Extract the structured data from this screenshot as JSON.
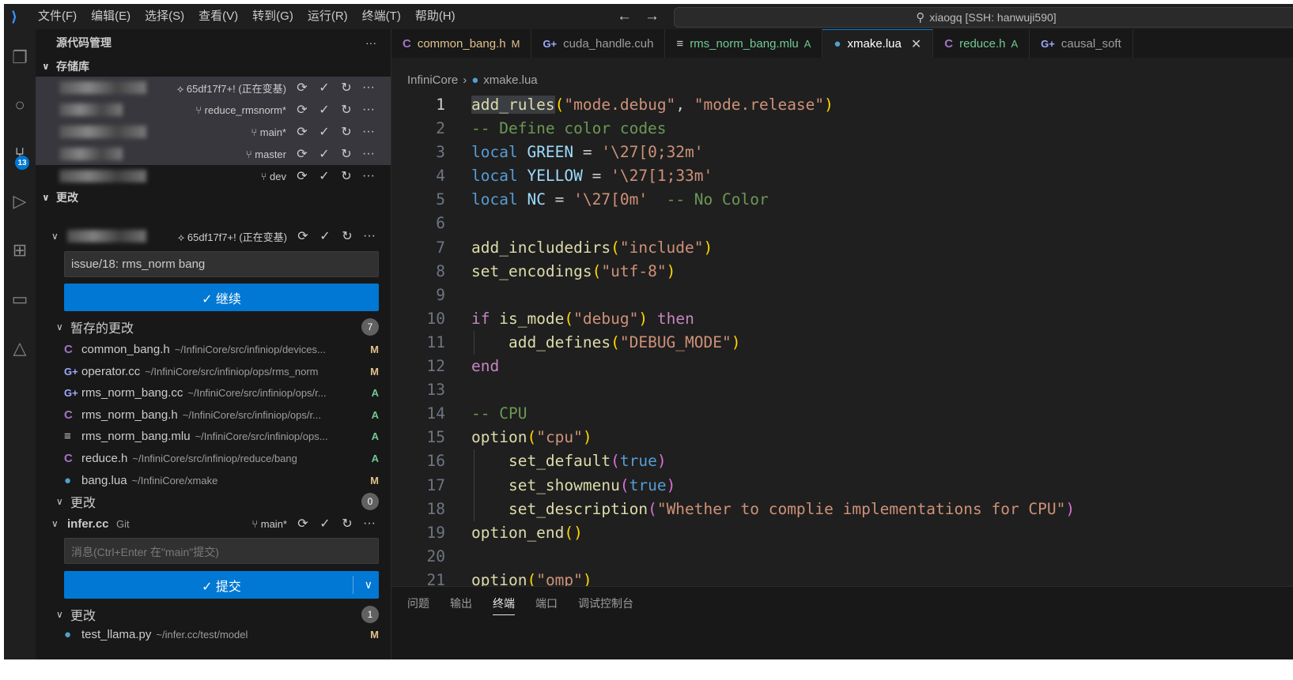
{
  "titlebar": {
    "menu": [
      "文件(F)",
      "编辑(E)",
      "选择(S)",
      "查看(V)",
      "转到(G)",
      "运行(R)",
      "终端(T)",
      "帮助(H)"
    ],
    "search_text": "xiaogq [SSH: hanwuji590]"
  },
  "activity": {
    "scm_badge": "13"
  },
  "sidebar": {
    "title": "源代码管理",
    "more": "···",
    "repositories_title": "存储库",
    "repos": [
      {
        "branch": "65df17f7+! (正在变基)"
      },
      {
        "branch": "reduce_rmsnorm*"
      },
      {
        "branch": "main*"
      },
      {
        "branch": "master"
      },
      {
        "branch": "dev"
      }
    ],
    "changes_title": "更改",
    "repo1": {
      "branch": "65df17f7+! (正在变基)",
      "message": "issue/18: rms_norm bang",
      "button": "✓ 继续",
      "staged_title": "暂存的更改",
      "staged_count": "7",
      "staged": [
        {
          "icon": "C",
          "name": "common_bang.h",
          "path": "~/InfiniCore/src/infiniop/devices...",
          "status": "M"
        },
        {
          "icon": "G+",
          "name": "operator.cc",
          "path": "~/InfiniCore/src/infiniop/ops/rms_norm",
          "status": "M"
        },
        {
          "icon": "G+",
          "name": "rms_norm_bang.cc",
          "path": "~/InfiniCore/src/infiniop/ops/r...",
          "status": "A"
        },
        {
          "icon": "C",
          "name": "rms_norm_bang.h",
          "path": "~/InfiniCore/src/infiniop/ops/r...",
          "status": "A"
        },
        {
          "icon": "≡",
          "name": "rms_norm_bang.mlu",
          "path": "~/InfiniCore/src/infiniop/ops...",
          "status": "A"
        },
        {
          "icon": "C",
          "name": "reduce.h",
          "path": "~/InfiniCore/src/infiniop/reduce/bang",
          "status": "A"
        },
        {
          "icon": "lua",
          "name": "bang.lua",
          "path": "~/InfiniCore/xmake",
          "status": "M"
        }
      ],
      "changes_title": "更改",
      "changes_count": "0"
    },
    "repo2": {
      "name": "infer.cc",
      "kind": "Git",
      "branch": "main*",
      "placeholder": "消息(Ctrl+Enter 在\"main\"提交)",
      "button": "✓ 提交",
      "changes_title": "更改",
      "changes_count": "1",
      "partial_file": "test_llama.py",
      "partial_path": "~/infer.cc/test/model",
      "partial_status": "M"
    }
  },
  "editor": {
    "tabs": [
      {
        "icon": "C",
        "label": "common_bang.h",
        "status": "M"
      },
      {
        "icon": "G+",
        "label": "cuda_handle.cuh",
        "status": ""
      },
      {
        "icon": "≡",
        "label": "rms_norm_bang.mlu",
        "status": "A"
      },
      {
        "icon": "lua",
        "label": "xmake.lua",
        "status": "",
        "active": true
      },
      {
        "icon": "C",
        "label": "reduce.h",
        "status": "A"
      },
      {
        "icon": "G+",
        "label": "causal_soft",
        "status": ""
      }
    ],
    "breadcrumb": [
      "InfiniCore",
      "xmake.lua"
    ],
    "code_lines": [
      [
        [
          "add_rules",
          "fn hl"
        ],
        [
          "(",
          "br"
        ],
        [
          "\"mode.debug\"",
          "str"
        ],
        [
          ", ",
          ""
        ],
        [
          "\"mode.release\"",
          "str"
        ],
        [
          ")",
          "br"
        ]
      ],
      [
        [
          "-- Define color codes",
          "com"
        ]
      ],
      [
        [
          "local ",
          "kw"
        ],
        [
          "GREEN",
          "var"
        ],
        [
          " = ",
          ""
        ],
        [
          "'\\27[0;32m'",
          "str"
        ]
      ],
      [
        [
          "local ",
          "kw"
        ],
        [
          "YELLOW",
          "var"
        ],
        [
          " = ",
          ""
        ],
        [
          "'\\27[1;33m'",
          "str"
        ]
      ],
      [
        [
          "local ",
          "kw"
        ],
        [
          "NC",
          "var"
        ],
        [
          " = ",
          ""
        ],
        [
          "'\\27[0m'",
          "str"
        ],
        [
          "  -- No Color",
          "com"
        ]
      ],
      [],
      [
        [
          "add_includedirs",
          "fn"
        ],
        [
          "(",
          "br"
        ],
        [
          "\"include\"",
          "str"
        ],
        [
          ")",
          "br"
        ]
      ],
      [
        [
          "set_encodings",
          "fn"
        ],
        [
          "(",
          "br"
        ],
        [
          "\"utf-8\"",
          "str"
        ],
        [
          ")",
          "br"
        ]
      ],
      [],
      [
        [
          "if ",
          "ctl"
        ],
        [
          "is_mode",
          "fn"
        ],
        [
          "(",
          "br"
        ],
        [
          "\"debug\"",
          "str"
        ],
        [
          ")",
          "br"
        ],
        [
          " then",
          "ctl"
        ]
      ],
      [
        [
          "    ",
          ""
        ],
        [
          "add_defines",
          "fn"
        ],
        [
          "(",
          "br"
        ],
        [
          "\"DEBUG_MODE\"",
          "str"
        ],
        [
          ")",
          "br"
        ]
      ],
      [
        [
          "end",
          "ctl"
        ]
      ],
      [],
      [
        [
          "-- CPU",
          "com"
        ]
      ],
      [
        [
          "option",
          "fn"
        ],
        [
          "(",
          "br"
        ],
        [
          "\"cpu\"",
          "str"
        ],
        [
          ")",
          "br"
        ]
      ],
      [
        [
          "    ",
          ""
        ],
        [
          "set_default",
          "fn"
        ],
        [
          "(",
          "br2"
        ],
        [
          "true",
          "kw"
        ],
        [
          ")",
          "br2"
        ]
      ],
      [
        [
          "    ",
          ""
        ],
        [
          "set_showmenu",
          "fn"
        ],
        [
          "(",
          "br2"
        ],
        [
          "true",
          "kw"
        ],
        [
          ")",
          "br2"
        ]
      ],
      [
        [
          "    ",
          ""
        ],
        [
          "set_description",
          "fn"
        ],
        [
          "(",
          "br2"
        ],
        [
          "\"Whether to complie implementations for CPU\"",
          "str"
        ],
        [
          ")",
          "br2"
        ]
      ],
      [
        [
          "option_end",
          "fn"
        ],
        [
          "()",
          "br"
        ]
      ],
      [],
      [
        [
          "option",
          "fn"
        ],
        [
          "(",
          "br"
        ],
        [
          "\"omp\"",
          "str"
        ],
        [
          ")",
          "br"
        ]
      ]
    ]
  },
  "panel": {
    "tabs": [
      "问题",
      "输出",
      "终端",
      "端口",
      "调试控制台"
    ],
    "active": "终端"
  },
  "colors": {
    "accent": "#0078d4",
    "modified": "#e2c08d",
    "added": "#73c991"
  }
}
